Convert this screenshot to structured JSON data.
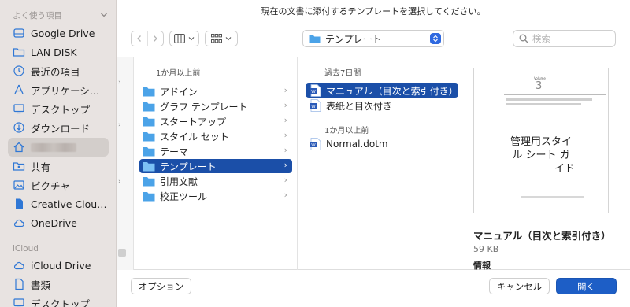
{
  "dialog_title": "現在の文書に添付するテンプレートを選択してください。",
  "sidebar": {
    "section_favorites": "よく使う項目",
    "section_icloud": "iCloud",
    "items": [
      {
        "label": "Google Drive",
        "icon": "google-drive-icon"
      },
      {
        "label": "LAN DISK",
        "icon": "folder-icon"
      },
      {
        "label": "最近の項目",
        "icon": "clock-icon"
      },
      {
        "label": "アプリケーション",
        "icon": "applications-icon"
      },
      {
        "label": "デスクトップ",
        "icon": "desktop-icon"
      },
      {
        "label": "ダウンロード",
        "icon": "download-icon"
      },
      {
        "label": "",
        "icon": "home-icon"
      },
      {
        "label": "共有",
        "icon": "shared-folder-icon"
      },
      {
        "label": "ピクチャ",
        "icon": "pictures-icon"
      },
      {
        "label": "Creative Cloud...",
        "icon": "document-icon"
      },
      {
        "label": "OneDrive",
        "icon": "cloud-icon"
      }
    ],
    "icloud_items": [
      {
        "label": "iCloud Drive",
        "icon": "cloud-icon"
      },
      {
        "label": "書類",
        "icon": "document-icon"
      },
      {
        "label": "デスクトップ",
        "icon": "desktop-icon"
      }
    ]
  },
  "toolbar": {
    "location": "テンプレート",
    "search_placeholder": "検索"
  },
  "column1": {
    "header": "1か月以上前",
    "items": [
      "アドイン",
      "グラフ テンプレート",
      "スタートアップ",
      "スタイル セット",
      "テーマ",
      "テンプレート",
      "引用文献",
      "校正ツール"
    ],
    "selected_index": 5
  },
  "column2": {
    "header_recent": "過去7日間",
    "recent_items": [
      "マニュアル（目次と索引付き）",
      "表紙と目次付き"
    ],
    "header_old": "1か月以上前",
    "old_items": [
      "Normal.dotm"
    ]
  },
  "preview": {
    "thumb_vol": "Volume",
    "thumb_num": "3",
    "thumb_title_line1": "管理用スタイ",
    "thumb_title_line2": "ル シート ガ",
    "thumb_title_line3": "イド",
    "name": "マニュアル（目次と索引付き）",
    "size": "59 KB",
    "info_label": "情報"
  },
  "buttons": {
    "options": "オプション",
    "cancel": "キャンセル",
    "open": "開く"
  },
  "colors": {
    "accent": "#1d5ec6",
    "selection": "#1b4fa8",
    "folder": "#4ba3e8",
    "sidebar_bg": "#e8e3e1"
  }
}
